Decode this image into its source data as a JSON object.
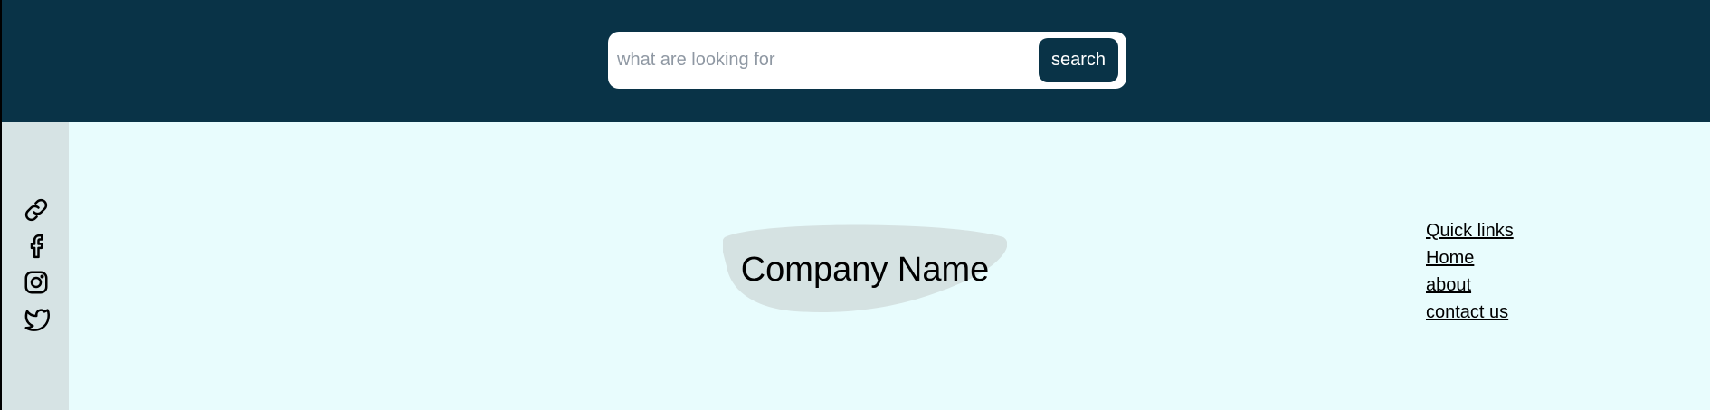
{
  "search": {
    "placeholder": "what are looking for",
    "button_label": "search"
  },
  "sidebar": {
    "icons": [
      "link-icon",
      "facebook-icon",
      "instagram-icon",
      "twitter-icon"
    ]
  },
  "brand": {
    "name": "Company Name"
  },
  "quick_links": {
    "heading": "Quick links",
    "items": [
      "Home",
      "about",
      "contact us"
    ]
  },
  "colors": {
    "header_bg": "#093347",
    "page_bg": "#e8fcfd",
    "sidebar_bg": "#d6e3e4",
    "button_bg": "#093347",
    "button_text": "#ffffff"
  }
}
